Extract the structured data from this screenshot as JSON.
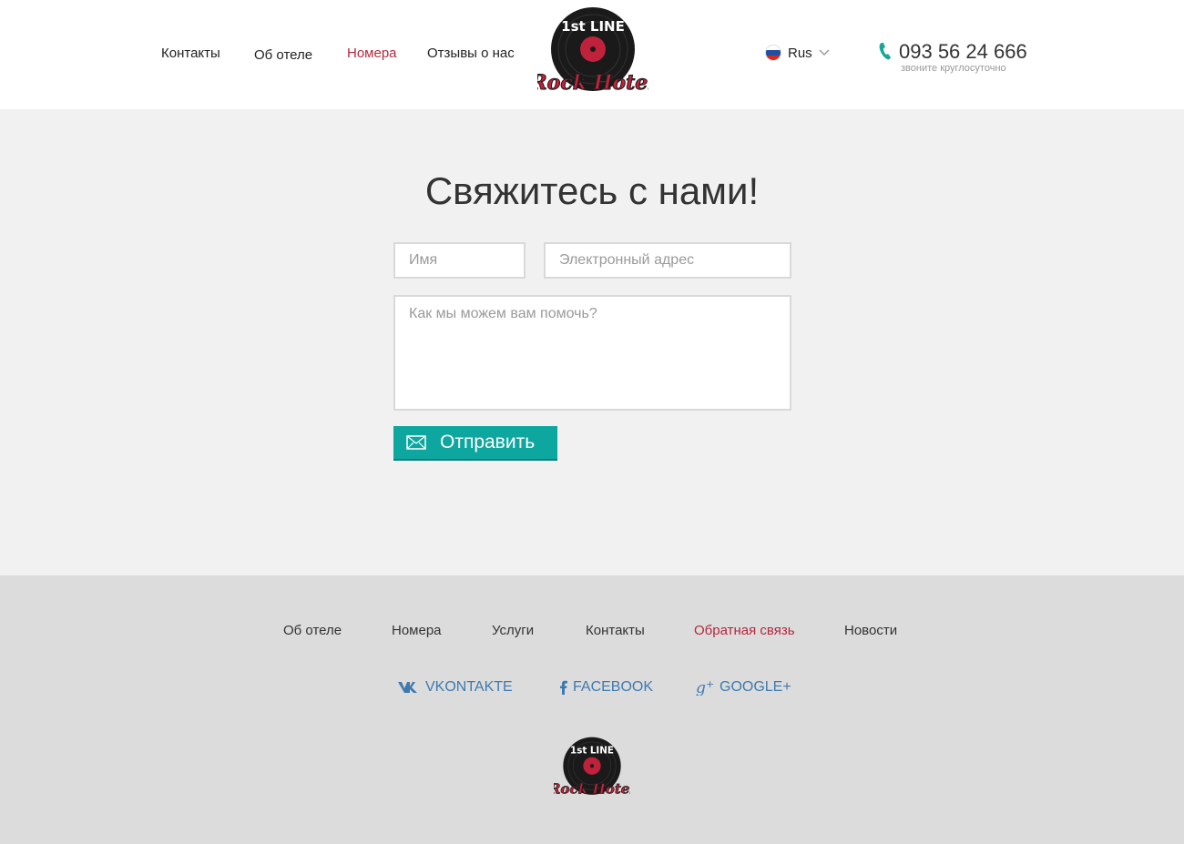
{
  "header": {
    "nav": [
      {
        "label": "Контакты",
        "active": false
      },
      {
        "label": "Об отеле",
        "active": false
      },
      {
        "label": "Номера",
        "active": true
      },
      {
        "label": "Отзывы о нас",
        "active": false
      }
    ],
    "logo": {
      "top_text": "1st LINE",
      "bottom_text": "Rock Hotel"
    },
    "language": {
      "label": "Rus",
      "icon": "russian-flag-icon"
    },
    "phone": {
      "number": "093 56 24 666",
      "note": "звоните круглосуточно",
      "icon": "phone-icon"
    }
  },
  "contact": {
    "title": "Свяжитесь с нами!",
    "name_placeholder": "Имя",
    "email_placeholder": "Электронный адрес",
    "message_placeholder": "Как мы можем вам помочь?",
    "submit_label": "Отправить"
  },
  "footer": {
    "nav": [
      {
        "label": "Об отеле",
        "active": false
      },
      {
        "label": "Номера",
        "active": false
      },
      {
        "label": "Услуги",
        "active": false
      },
      {
        "label": "Контакты",
        "active": false
      },
      {
        "label": "Обратная связь",
        "active": true
      },
      {
        "label": "Новости",
        "active": false
      }
    ],
    "social": [
      {
        "label": "VKONTAKTE",
        "icon": "vk-icon"
      },
      {
        "label": "FACEBOOK",
        "icon": "facebook-icon"
      },
      {
        "label": "GOOGLE+",
        "icon": "google-plus-icon"
      }
    ]
  },
  "colors": {
    "accent": "#b5283d",
    "button": "#0da7a0",
    "social": "#3e7ab0"
  }
}
